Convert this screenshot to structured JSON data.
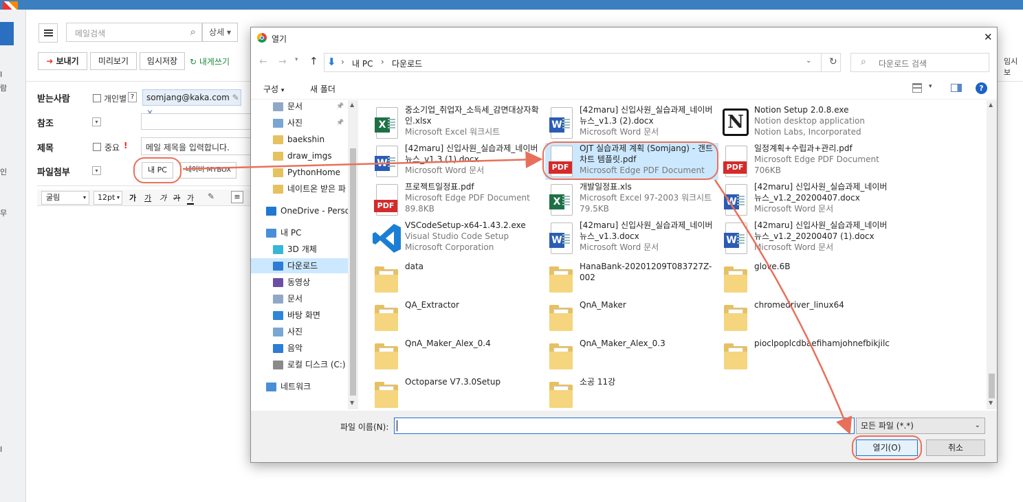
{
  "background": {
    "search_placeholder": "메일검색",
    "detail_label": "상세",
    "toolbar": {
      "send": "보내기",
      "preview": "미리보기",
      "save_draft": "임시저장",
      "self_write": "내게쓰기"
    },
    "recipient_label": "받는사람",
    "individual_label": "개인별",
    "help_label": "?",
    "recipient_chip": "somjang@kaka.com",
    "cc_label": "참조",
    "subject_label": "제목",
    "important_label": "중요",
    "important_mark": "!",
    "subject_value": "메일 제목을 입력합니다.",
    "attach_label": "파일첨부",
    "my_pc_button": "내 PC",
    "mybox_button": "네이버 MYBOX",
    "font_select": "굴림",
    "size_select": "12pt",
    "format_buttons": [
      "가",
      "가",
      "가",
      "가",
      "가"
    ],
    "right_edge_label": "임시보",
    "left_labels": [
      "람",
      "I",
      "인",
      "무",
      "I"
    ]
  },
  "dialog": {
    "title": "열기",
    "close": "✕",
    "breadcrumb": [
      "내 PC",
      "다운로드"
    ],
    "search_placeholder": "다운로드 검색",
    "organize": "구성",
    "new_folder": "새 폴더",
    "nav_items": [
      {
        "label": "문서",
        "icon": "document-icon"
      },
      {
        "label": "사진",
        "icon": "picture-icon"
      },
      {
        "label": "baekshin",
        "icon": "folder-icon"
      },
      {
        "label": "draw_imgs",
        "icon": "folder-icon"
      },
      {
        "label": "PythonHome",
        "icon": "folder-icon"
      },
      {
        "label": "네이트온 받은 파",
        "icon": "folder-icon"
      },
      {
        "label": "OneDrive - Persor",
        "icon": "cloud-icon"
      },
      {
        "label": "내 PC",
        "icon": "pc-icon"
      },
      {
        "label": "3D 개체",
        "icon": "cube-icon"
      },
      {
        "label": "다운로드",
        "icon": "download-icon"
      },
      {
        "label": "동영상",
        "icon": "video-icon"
      },
      {
        "label": "문서",
        "icon": "document-icon"
      },
      {
        "label": "바탕 화면",
        "icon": "desktop-icon"
      },
      {
        "label": "사진",
        "icon": "picture-icon"
      },
      {
        "label": "음악",
        "icon": "music-icon"
      },
      {
        "label": "로컬 디스크 (C:)",
        "icon": "disk-icon"
      },
      {
        "label": "네트워크",
        "icon": "network-icon"
      }
    ],
    "files": [
      {
        "name": "중소기업_취업자_소득세_감면대상자확인.xlsx",
        "type": "Microsoft Excel 워크시트",
        "extra": "",
        "icon": "excel"
      },
      {
        "name": "[42maru] 신입사원_실습과제_네이버뉴스_v1.3 (2).docx",
        "type": "Microsoft Word 문서",
        "extra": "",
        "icon": "word"
      },
      {
        "name": "Notion Setup 2.0.8.exe",
        "type": "Notion desktop application",
        "extra": "Notion Labs, Incorporated",
        "icon": "notion"
      },
      {
        "name": "[42maru] 신입사원_실습과제_네이버뉴스_v1.3 (1).docx",
        "type": "Microsoft Word 문서",
        "extra": "",
        "icon": "word"
      },
      {
        "name": "OJT 실습과제 계획 (Somjang) - 갠트 차트 템플릿.pdf",
        "type": "Microsoft Edge PDF Document",
        "extra": "",
        "icon": "pdf"
      },
      {
        "name": "일정계획+수립과+관리.pdf",
        "type": "Microsoft Edge PDF Document",
        "extra": "706KB",
        "icon": "pdf"
      },
      {
        "name": "프로젝트일정표.pdf",
        "type": "Microsoft Edge PDF Document",
        "extra": "89.8KB",
        "icon": "pdf"
      },
      {
        "name": "개발일정표.xls",
        "type": "Microsoft Excel 97-2003 워크시트",
        "extra": "79.5KB",
        "icon": "excel"
      },
      {
        "name": "[42maru] 신입사원_실습과제_네이버뉴스_v1.2_20200407.docx",
        "type": "Microsoft Word 문서",
        "extra": "",
        "icon": "word"
      },
      {
        "name": "VSCodeSetup-x64-1.43.2.exe",
        "type": "Visual Studio Code Setup",
        "extra": "Microsoft Corporation",
        "icon": "vscode"
      },
      {
        "name": "[42maru] 신입사원_실습과제_네이버뉴스_v1.3.docx",
        "type": "Microsoft Word 문서",
        "extra": "",
        "icon": "word"
      },
      {
        "name": "[42maru] 신입사원_실습과제_네이버뉴스_v1.2_20200407 (1).docx",
        "type": "Microsoft Word 문서",
        "extra": "",
        "icon": "word"
      },
      {
        "name": "data",
        "type": "",
        "extra": "",
        "icon": "folder"
      },
      {
        "name": "HanaBank-20201209T083727Z-002",
        "type": "",
        "extra": "",
        "icon": "folder"
      },
      {
        "name": "glove.6B",
        "type": "",
        "extra": "",
        "icon": "folder"
      },
      {
        "name": "QA_Extractor",
        "type": "",
        "extra": "",
        "icon": "folder"
      },
      {
        "name": "QnA_Maker",
        "type": "",
        "extra": "",
        "icon": "folder"
      },
      {
        "name": "chromedriver_linux64",
        "type": "",
        "extra": "",
        "icon": "folder"
      },
      {
        "name": "QnA_Maker_Alex_0.4",
        "type": "",
        "extra": "",
        "icon": "folder"
      },
      {
        "name": "QnA_Maker_Alex_0.3",
        "type": "",
        "extra": "",
        "icon": "folder"
      },
      {
        "name": "pioclpoplcdbaefihamjohnefbikjilc",
        "type": "",
        "extra": "",
        "icon": "folder"
      },
      {
        "name": "Octoparse V7.3.0Setup",
        "type": "",
        "extra": "",
        "icon": "folder"
      },
      {
        "name": "소공 11강",
        "type": "",
        "extra": "",
        "icon": "folder"
      }
    ],
    "filename_label": "파일 이름(N):",
    "filename_value": "",
    "filter": "모든 파일 (*.*)",
    "open_button": "열기(O)",
    "cancel_button": "취소"
  },
  "colors": {
    "accent": "#3b7fc0",
    "annotation": "#e8705a",
    "selection": "#cce8ff",
    "send": "#e53a2a"
  }
}
